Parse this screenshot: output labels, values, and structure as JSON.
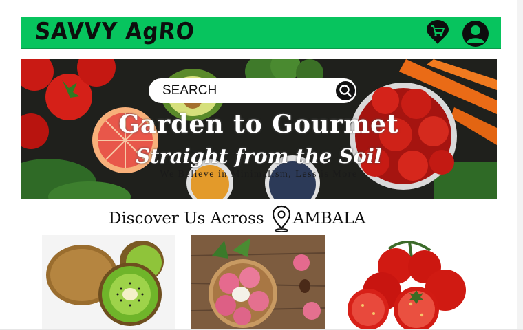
{
  "header": {
    "logo": "SAVVY AgRO",
    "brand_color": "#07c45e",
    "cart_icon": "cart-location-icon",
    "user_icon": "user-avatar-icon"
  },
  "hero": {
    "search_label": "SEARCH",
    "search_icon": "search-icon",
    "title": "Garden to Gourmet",
    "subtitle": "Straight from the Soil",
    "tagline": "We Believe in Minimalism, Less is More"
  },
  "discover": {
    "text": "Discover Us Across",
    "location_icon": "map-pin-icon",
    "city": "AMBALA"
  },
  "products": [
    {
      "name": "kiwi"
    },
    {
      "name": "litchi"
    },
    {
      "name": "tomato"
    }
  ]
}
